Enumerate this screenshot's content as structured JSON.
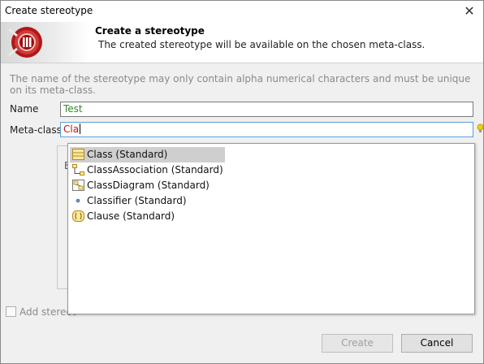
{
  "window": {
    "title": "Create stereotype",
    "close_glyph": "✕"
  },
  "banner": {
    "title": "Create a stereotype",
    "subtitle": "The created stereotype will be available on the chosen meta-class.",
    "logo_icon": "modelio-logo-icon"
  },
  "info_text": "The name of the stereotype may only contain alpha numerical characters and must be unique on its meta-class.",
  "form": {
    "name_label": "Name",
    "name_value": "Test",
    "metaclass_label": "Meta-class",
    "metaclass_value": "Cla",
    "hint_icon": "lightbulb-icon"
  },
  "background": {
    "partial_letter": "E",
    "add_checkbox_label": "Add stereot",
    "add_checkbox_checked": false
  },
  "completion": {
    "items": [
      {
        "label": "Class (Standard)",
        "icon": "class-icon",
        "selected": true
      },
      {
        "label": "ClassAssociation (Standard)",
        "icon": "class-association-icon",
        "selected": false
      },
      {
        "label": "ClassDiagram (Standard)",
        "icon": "class-diagram-icon",
        "selected": false
      },
      {
        "label": "Classifier (Standard)",
        "icon": "classifier-icon",
        "selected": false
      },
      {
        "label": "Clause (Standard)",
        "icon": "clause-icon",
        "selected": false
      }
    ]
  },
  "buttons": {
    "create": "Create",
    "create_enabled": false,
    "cancel": "Cancel"
  }
}
